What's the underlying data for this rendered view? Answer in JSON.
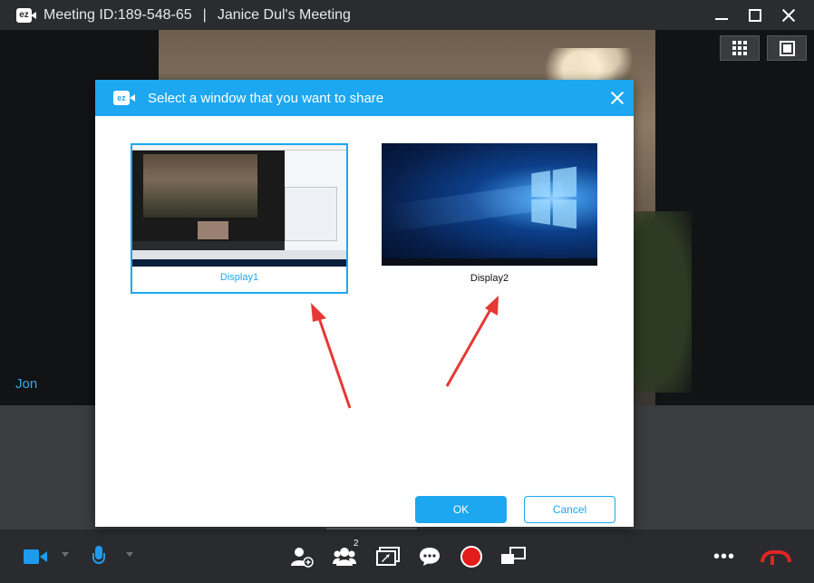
{
  "window": {
    "meeting_id": "Meeting ID:189-548-65",
    "separator": "|",
    "meeting_name": "Janice Dul's Meeting",
    "logo_text": "ez"
  },
  "video": {
    "participant_name": "Jon"
  },
  "toolbar": {
    "participants_count": "2"
  },
  "dialog": {
    "title": "Select a window that you want to share",
    "logo_text": "ez",
    "displays": [
      {
        "label": "Display1",
        "selected": true
      },
      {
        "label": "Display2",
        "selected": false
      }
    ],
    "ok_label": "OK",
    "cancel_label": "Cancel"
  },
  "colors": {
    "accent": "#1da7f0",
    "record": "#e31b1b",
    "hangup": "#e02424",
    "annotation_arrow": "#e53935"
  },
  "icons": [
    "camera-icon",
    "microphone-icon",
    "add-participant-icon",
    "participants-icon",
    "share-screen-icon",
    "chat-icon",
    "record-icon",
    "switch-display-icon",
    "more-icon",
    "hang-up-icon",
    "grid-view-icon",
    "fullscreen-icon",
    "minimize-icon",
    "maximize-icon",
    "close-icon"
  ]
}
